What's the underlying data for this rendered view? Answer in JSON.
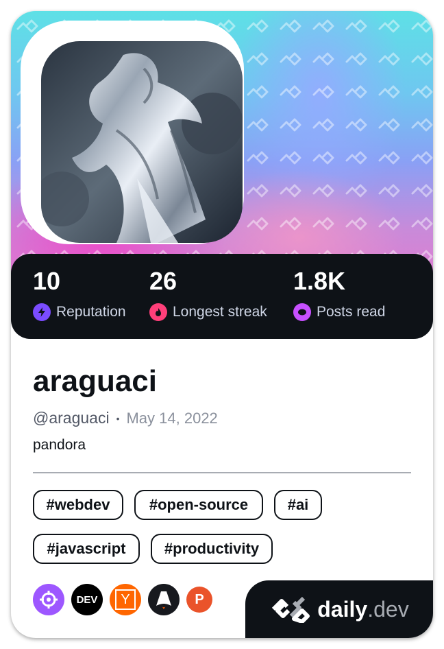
{
  "profile": {
    "name": "araguaci",
    "handle": "@araguaci",
    "separator": "•",
    "joined": "May 14, 2022",
    "bio": "pandora",
    "avatar_icon": "silver-surfer-avatar"
  },
  "stats": [
    {
      "value": "10",
      "label": "Reputation",
      "icon": "lightning-icon",
      "color": "#7b4cff"
    },
    {
      "value": "26",
      "label": "Longest streak",
      "icon": "flame-icon",
      "color": "#ff3f7a"
    },
    {
      "value": "1.8K",
      "label": "Posts read",
      "icon": "eye-icon",
      "color": "#c750ff"
    }
  ],
  "tags": [
    "#webdev",
    "#open-source",
    "#ai",
    "#javascript",
    "#productivity"
  ],
  "sources": [
    {
      "name": "crosshair-source-icon",
      "color": "#9d57ff"
    },
    {
      "name": "dev-source-icon",
      "label": "DEV",
      "color": "#000000"
    },
    {
      "name": "hacker-news-source-icon",
      "label": "Y",
      "color": "#ff6600"
    },
    {
      "name": "astro-source-icon",
      "color": "#17191e"
    },
    {
      "name": "producthunt-source-icon",
      "label": "P",
      "color": "#ea532a"
    }
  ],
  "brand": {
    "name": "daily",
    "suffix": ".dev"
  }
}
